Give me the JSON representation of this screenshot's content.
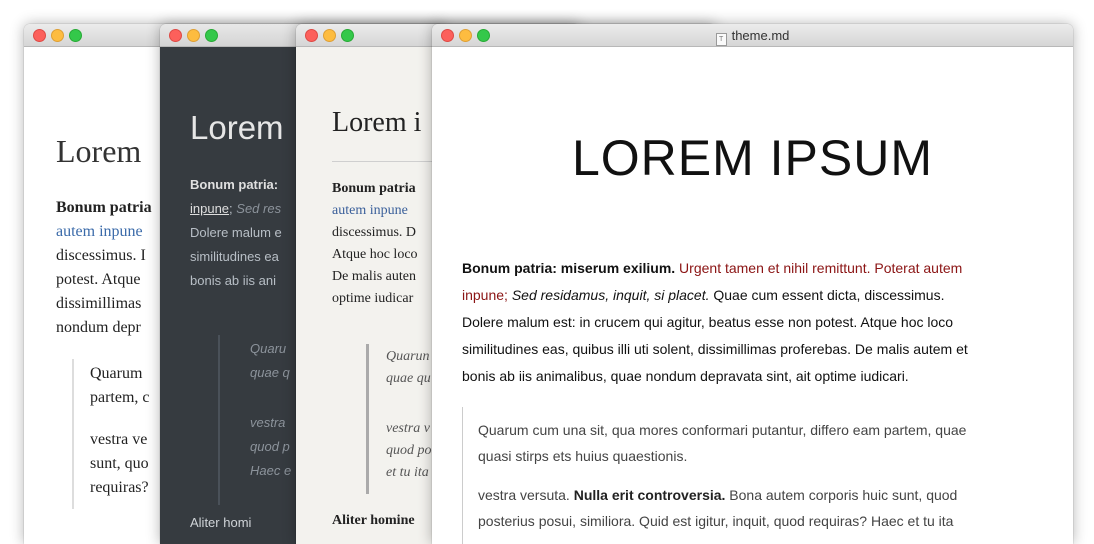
{
  "windows": {
    "github": {
      "heading": "Lorem",
      "lines": {
        "l1": "Bonum patria",
        "l2": "autem inpune",
        "l3": "discessimus. I",
        "l4": "potest. Atque",
        "l5": "dissimillimas",
        "l6": "nondum depr",
        "q1": "Quarum",
        "q2": "partem, c",
        "q3": "vestra ve",
        "q4": "sunt, quo",
        "q5": "requiras?"
      }
    },
    "night": {
      "heading": "Lorem",
      "lines": {
        "l1": "Bonum patria:",
        "l2a": "inpune",
        "l2b": "; ",
        "l2c": "Sed res",
        "l3": "Dolere malum e",
        "l4": "similitudines ea",
        "l5": "bonis ab iis ani",
        "q1": "Quaru",
        "q2": "quae q",
        "q3": "vestra",
        "q4": "quod p",
        "q5": "Haec e",
        "bottom": "Aliter homi"
      }
    },
    "newsprint": {
      "heading": "Lorem i",
      "lines": {
        "l1": "Bonum patria",
        "l2": "autem inpune",
        "l3": "discessimus. D",
        "l4": "Atque hoc loco",
        "l5": "De malis auten",
        "l6": "optime iudicar",
        "q1": "Quarun",
        "q2": "quae qu",
        "q3": "vestra v",
        "q4": "quod po",
        "q5": "et tu ita",
        "bottom": "Aliter homine"
      }
    },
    "whitey": {
      "title": "theme.md",
      "file_icon_glyph": "T",
      "heading": "LOREM IPSUM",
      "para": {
        "bold": "Bonum patria: miserum exilium.",
        "red1": " Urgent tamen et nihil remittunt. Poterat autem",
        "red2": "inpune;",
        "ital": " Sed residamus, inquit, si placet.",
        "rest2": " Quae cum essent dicta, discessimus.",
        "line3": "Dolere malum est: in crucem qui agitur, beatus esse non potest. Atque hoc loco",
        "line4": "similitudines eas, quibus illi uti solent, dissimillimas proferebas. De malis autem et",
        "line5": "bonis ab iis animalibus, quae nondum depravata sint, ait optime iudicari."
      },
      "quote": {
        "line1": "Quarum cum una sit, qua mores conformari putantur, differo eam partem, quae",
        "line2": "quasi stirps ets huius quaestionis.",
        "line3a": "vestra versuta. ",
        "line3b": "Nulla erit controversia.",
        "line3c": " Bona autem corporis huic sunt, quod",
        "line4": "posterius posui, similiora. Quid est igitur, inquit, quod requiras? Haec et tu ita"
      }
    }
  }
}
